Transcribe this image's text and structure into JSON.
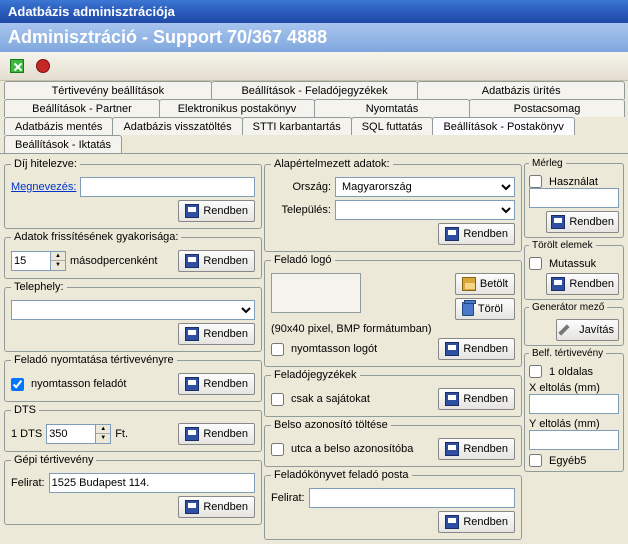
{
  "window": {
    "title": "Adatbázis adminisztrációja"
  },
  "subtitle": "Adminisztráció - Support 70/367 4888",
  "tabs": {
    "row1": [
      "Tértivevény beállítások",
      "Beállítások - Feladójegyzékek",
      "Adatbázis ürítés"
    ],
    "row2": [
      "Beállítások - Partner",
      "Elektronikus postakönyv",
      "Nyomtatás",
      "Postacsomag"
    ],
    "row3": [
      "Adatbázis mentés",
      "Adatbázis visszatöltés",
      "STTI karbantartás",
      "SQL futtatás",
      "Beállítások - Postakönyv",
      "Beállítások - Iktatás"
    ]
  },
  "labels": {
    "rendben": "Rendben",
    "betolt": "Betölt",
    "torol": "Töröl",
    "javitas": "Javítás"
  },
  "fs": {
    "dij": {
      "legend": "Díj hitelezve:",
      "megnev": "Megnevezés:"
    },
    "frissit": {
      "legend": "Adatok frissítésének gyakorisága:",
      "val": "15",
      "unit": "másodpercenként"
    },
    "telephely": {
      "legend": "Telephely:"
    },
    "nyomt_tertiv": {
      "legend": "Feladó nyomtatása tértivevényre",
      "chk": "nyomtasson feladót"
    },
    "dts": {
      "legend": "DTS",
      "pre": "1 DTS",
      "val": "350",
      "suf": "Ft."
    },
    "gepi": {
      "legend": "Gépi tértivevény",
      "felirat_lbl": "Felirat:",
      "felirat_val": "1525 Budapest 114."
    },
    "alap": {
      "legend": "Alapértelmezett adatok:",
      "orszag_lbl": "Ország:",
      "orszag_val": "Magyarország",
      "telep_lbl": "Település:"
    },
    "logo": {
      "legend": "Feladó logó",
      "hint": "(90x40 pixel, BMP formátumban)",
      "chk": "nyomtasson logót"
    },
    "fjegyzek": {
      "legend": "Feladójegyzékek",
      "chk": "csak a sajátokat"
    },
    "belso": {
      "legend": "Belso azonosító töltése",
      "chk": "utca a belso azonosítóba"
    },
    "fposta": {
      "legend": "Feladókönyvet feladó posta",
      "felirat": "Felirat:"
    },
    "merleg": {
      "legend": "Mérleg",
      "chk": "Használat"
    },
    "torolt": {
      "legend": "Törölt elemek",
      "chk": "Mutassuk"
    },
    "gen": {
      "legend": "Generátor mező"
    },
    "belf": {
      "legend": "Belf. tértivevény",
      "chk": "1 oldalas",
      "x": "X eltolás (mm)",
      "y": "Y eltolás (mm)",
      "eb": "Egyéb5"
    }
  }
}
